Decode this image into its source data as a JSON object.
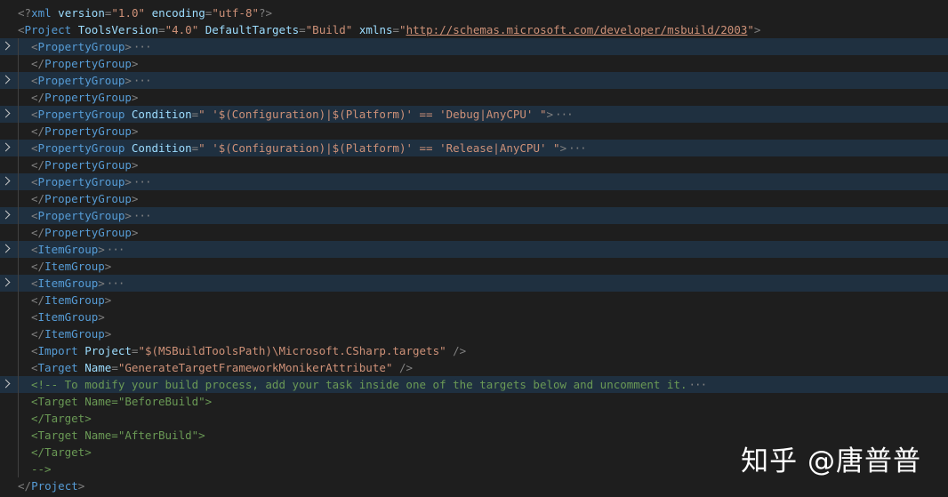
{
  "lines": [
    {
      "folded": false,
      "indent": 0,
      "parts": [
        [
          "p",
          "<?"
        ],
        [
          "t",
          "xml"
        ],
        [
          "p",
          " "
        ],
        [
          "a",
          "version"
        ],
        [
          "p",
          "="
        ],
        [
          "s",
          "\"1.0\""
        ],
        [
          "p",
          " "
        ],
        [
          "a",
          "encoding"
        ],
        [
          "p",
          "="
        ],
        [
          "s",
          "\"utf-8\""
        ],
        [
          "p",
          "?>"
        ]
      ]
    },
    {
      "folded": false,
      "indent": 0,
      "parts": [
        [
          "p",
          "<"
        ],
        [
          "t",
          "Project"
        ],
        [
          "p",
          " "
        ],
        [
          "a",
          "ToolsVersion"
        ],
        [
          "p",
          "="
        ],
        [
          "s",
          "\"4.0\""
        ],
        [
          "p",
          " "
        ],
        [
          "a",
          "DefaultTargets"
        ],
        [
          "p",
          "="
        ],
        [
          "s",
          "\"Build\""
        ],
        [
          "p",
          " "
        ],
        [
          "a",
          "xmlns"
        ],
        [
          "p",
          "="
        ],
        [
          "s",
          "\""
        ],
        [
          "u",
          "http://schemas.microsoft.com/developer/msbuild/2003"
        ],
        [
          "s",
          "\""
        ],
        [
          "p",
          ">"
        ]
      ]
    },
    {
      "folded": true,
      "indent": 1,
      "parts": [
        [
          "p",
          "<"
        ],
        [
          "t",
          "PropertyGroup"
        ],
        [
          "p",
          ">"
        ]
      ],
      "ellipsis": "···"
    },
    {
      "folded": false,
      "indent": 1,
      "parts": [
        [
          "p",
          "</"
        ],
        [
          "t",
          "PropertyGroup"
        ],
        [
          "p",
          ">"
        ]
      ]
    },
    {
      "folded": true,
      "indent": 1,
      "parts": [
        [
          "p",
          "<"
        ],
        [
          "t",
          "PropertyGroup"
        ],
        [
          "p",
          ">"
        ]
      ],
      "ellipsis": "···"
    },
    {
      "folded": false,
      "indent": 1,
      "parts": [
        [
          "p",
          "</"
        ],
        [
          "t",
          "PropertyGroup"
        ],
        [
          "p",
          ">"
        ]
      ]
    },
    {
      "folded": true,
      "indent": 1,
      "parts": [
        [
          "p",
          "<"
        ],
        [
          "t",
          "PropertyGroup"
        ],
        [
          "p",
          " "
        ],
        [
          "a",
          "Condition"
        ],
        [
          "p",
          "="
        ],
        [
          "s",
          "\" '$(Configuration)|$(Platform)' == 'Debug|AnyCPU' \""
        ],
        [
          "p",
          ">"
        ]
      ],
      "ellipsis": "···"
    },
    {
      "folded": false,
      "indent": 1,
      "parts": [
        [
          "p",
          "</"
        ],
        [
          "t",
          "PropertyGroup"
        ],
        [
          "p",
          ">"
        ]
      ]
    },
    {
      "folded": true,
      "indent": 1,
      "parts": [
        [
          "p",
          "<"
        ],
        [
          "t",
          "PropertyGroup"
        ],
        [
          "p",
          " "
        ],
        [
          "a",
          "Condition"
        ],
        [
          "p",
          "="
        ],
        [
          "s",
          "\" '$(Configuration)|$(Platform)' == 'Release|AnyCPU' \""
        ],
        [
          "p",
          ">"
        ]
      ],
      "ellipsis": "···"
    },
    {
      "folded": false,
      "indent": 1,
      "parts": [
        [
          "p",
          "</"
        ],
        [
          "t",
          "PropertyGroup"
        ],
        [
          "p",
          ">"
        ]
      ]
    },
    {
      "folded": true,
      "indent": 1,
      "parts": [
        [
          "p",
          "<"
        ],
        [
          "t",
          "PropertyGroup"
        ],
        [
          "p",
          ">"
        ]
      ],
      "ellipsis": "···"
    },
    {
      "folded": false,
      "indent": 1,
      "parts": [
        [
          "p",
          "</"
        ],
        [
          "t",
          "PropertyGroup"
        ],
        [
          "p",
          ">"
        ]
      ]
    },
    {
      "folded": true,
      "indent": 1,
      "parts": [
        [
          "p",
          "<"
        ],
        [
          "t",
          "PropertyGroup"
        ],
        [
          "p",
          ">"
        ]
      ],
      "ellipsis": "···"
    },
    {
      "folded": false,
      "indent": 1,
      "parts": [
        [
          "p",
          "</"
        ],
        [
          "t",
          "PropertyGroup"
        ],
        [
          "p",
          ">"
        ]
      ]
    },
    {
      "folded": true,
      "indent": 1,
      "parts": [
        [
          "p",
          "<"
        ],
        [
          "t",
          "ItemGroup"
        ],
        [
          "p",
          ">"
        ]
      ],
      "ellipsis": "···"
    },
    {
      "folded": false,
      "indent": 1,
      "parts": [
        [
          "p",
          "</"
        ],
        [
          "t",
          "ItemGroup"
        ],
        [
          "p",
          ">"
        ]
      ]
    },
    {
      "folded": true,
      "indent": 1,
      "parts": [
        [
          "p",
          "<"
        ],
        [
          "t",
          "ItemGroup"
        ],
        [
          "p",
          ">"
        ]
      ],
      "ellipsis": "···"
    },
    {
      "folded": false,
      "indent": 1,
      "parts": [
        [
          "p",
          "</"
        ],
        [
          "t",
          "ItemGroup"
        ],
        [
          "p",
          ">"
        ]
      ]
    },
    {
      "folded": false,
      "indent": 1,
      "parts": [
        [
          "p",
          "<"
        ],
        [
          "t",
          "ItemGroup"
        ],
        [
          "p",
          ">"
        ]
      ]
    },
    {
      "folded": false,
      "indent": 1,
      "parts": [
        [
          "p",
          "</"
        ],
        [
          "t",
          "ItemGroup"
        ],
        [
          "p",
          ">"
        ]
      ]
    },
    {
      "folded": false,
      "indent": 1,
      "parts": [
        [
          "p",
          "<"
        ],
        [
          "t",
          "Import"
        ],
        [
          "p",
          " "
        ],
        [
          "a",
          "Project"
        ],
        [
          "p",
          "="
        ],
        [
          "s",
          "\"$(MSBuildToolsPath)\\Microsoft.CSharp.targets\""
        ],
        [
          "p",
          " />"
        ]
      ]
    },
    {
      "folded": false,
      "indent": 1,
      "parts": [
        [
          "p",
          "<"
        ],
        [
          "t",
          "Target"
        ],
        [
          "p",
          " "
        ],
        [
          "a",
          "Name"
        ],
        [
          "p",
          "="
        ],
        [
          "s",
          "\"GenerateTargetFrameworkMonikerAttribute\""
        ],
        [
          "p",
          " />"
        ]
      ]
    },
    {
      "folded": true,
      "indent": 1,
      "parts": [
        [
          "c",
          "<!-- To modify your build process, add your task inside one of the targets below and uncomment it."
        ]
      ],
      "ellipsis": "···"
    },
    {
      "folded": false,
      "indent": 1,
      "parts": [
        [
          "c",
          "<Target Name=\"BeforeBuild\">"
        ]
      ]
    },
    {
      "folded": false,
      "indent": 1,
      "parts": [
        [
          "c",
          "</Target>"
        ]
      ]
    },
    {
      "folded": false,
      "indent": 1,
      "parts": [
        [
          "c",
          "<Target Name=\"AfterBuild\">"
        ]
      ]
    },
    {
      "folded": false,
      "indent": 1,
      "parts": [
        [
          "c",
          "</Target>"
        ]
      ]
    },
    {
      "folded": false,
      "indent": 1,
      "parts": [
        [
          "c",
          "-->"
        ]
      ]
    },
    {
      "folded": false,
      "indent": 0,
      "parts": [
        [
          "p",
          "</"
        ],
        [
          "t",
          "Project"
        ],
        [
          "p",
          ">"
        ]
      ]
    }
  ],
  "watermark": "知乎 @唐普普"
}
